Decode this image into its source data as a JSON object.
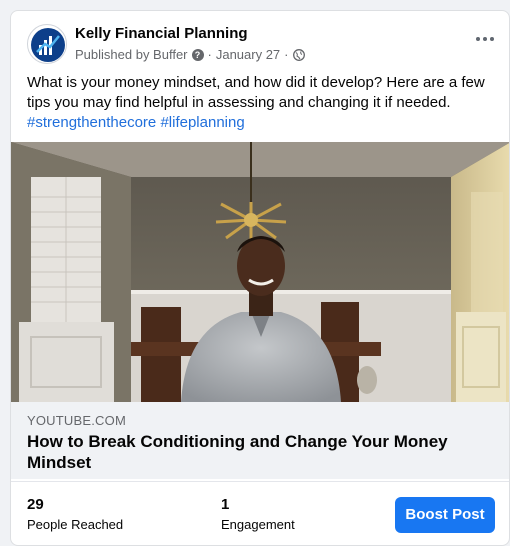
{
  "post": {
    "page_name": "Kelly Financial Planning",
    "publisher": "Published by Buffer",
    "separator": "·",
    "date": "January 27",
    "text": "What is your money mindset, and how did it develop? Here are a few tips you may find  helpful in assessing and changing it if needed.",
    "hashtags": [
      "#strengthenthecore",
      "#lifeplanning"
    ]
  },
  "link_preview": {
    "domain": "YOUTUBE.COM",
    "title": "How to Break Conditioning and Change Your Money Mindset"
  },
  "insights": {
    "reached_value": "29",
    "reached_label": "People Reached",
    "engagement_value": "1",
    "engagement_label": "Engagement",
    "boost_label": "Boost Post"
  },
  "icons": {
    "avatar": "kfp-logo-icon",
    "help": "question-circle-icon",
    "privacy": "globe-icon",
    "menu": "more-horizontal-icon"
  },
  "colors": {
    "accent": "#1877f2",
    "hashtag": "#216fdb",
    "muted": "#65676b"
  }
}
